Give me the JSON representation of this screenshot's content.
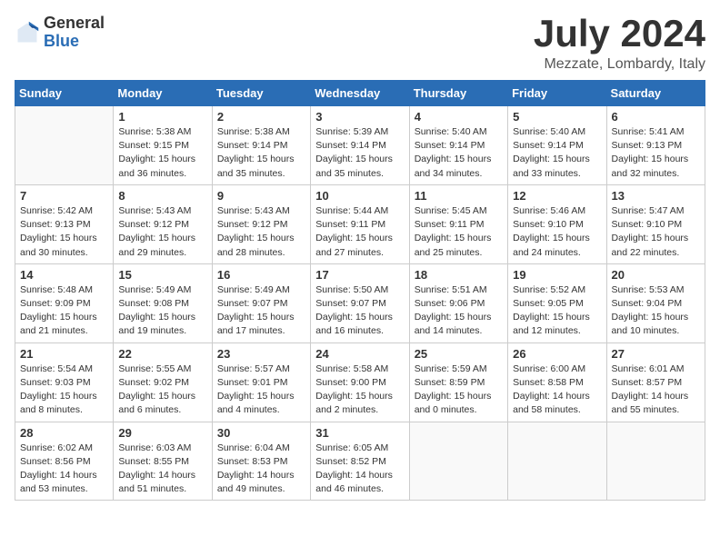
{
  "header": {
    "logo_general": "General",
    "logo_blue": "Blue",
    "month_year": "July 2024",
    "location": "Mezzate, Lombardy, Italy"
  },
  "weekdays": [
    "Sunday",
    "Monday",
    "Tuesday",
    "Wednesday",
    "Thursday",
    "Friday",
    "Saturday"
  ],
  "weeks": [
    [
      {
        "day": "",
        "info": ""
      },
      {
        "day": "1",
        "info": "Sunrise: 5:38 AM\nSunset: 9:15 PM\nDaylight: 15 hours\nand 36 minutes."
      },
      {
        "day": "2",
        "info": "Sunrise: 5:38 AM\nSunset: 9:14 PM\nDaylight: 15 hours\nand 35 minutes."
      },
      {
        "day": "3",
        "info": "Sunrise: 5:39 AM\nSunset: 9:14 PM\nDaylight: 15 hours\nand 35 minutes."
      },
      {
        "day": "4",
        "info": "Sunrise: 5:40 AM\nSunset: 9:14 PM\nDaylight: 15 hours\nand 34 minutes."
      },
      {
        "day": "5",
        "info": "Sunrise: 5:40 AM\nSunset: 9:14 PM\nDaylight: 15 hours\nand 33 minutes."
      },
      {
        "day": "6",
        "info": "Sunrise: 5:41 AM\nSunset: 9:13 PM\nDaylight: 15 hours\nand 32 minutes."
      }
    ],
    [
      {
        "day": "7",
        "info": "Sunrise: 5:42 AM\nSunset: 9:13 PM\nDaylight: 15 hours\nand 30 minutes."
      },
      {
        "day": "8",
        "info": "Sunrise: 5:43 AM\nSunset: 9:12 PM\nDaylight: 15 hours\nand 29 minutes."
      },
      {
        "day": "9",
        "info": "Sunrise: 5:43 AM\nSunset: 9:12 PM\nDaylight: 15 hours\nand 28 minutes."
      },
      {
        "day": "10",
        "info": "Sunrise: 5:44 AM\nSunset: 9:11 PM\nDaylight: 15 hours\nand 27 minutes."
      },
      {
        "day": "11",
        "info": "Sunrise: 5:45 AM\nSunset: 9:11 PM\nDaylight: 15 hours\nand 25 minutes."
      },
      {
        "day": "12",
        "info": "Sunrise: 5:46 AM\nSunset: 9:10 PM\nDaylight: 15 hours\nand 24 minutes."
      },
      {
        "day": "13",
        "info": "Sunrise: 5:47 AM\nSunset: 9:10 PM\nDaylight: 15 hours\nand 22 minutes."
      }
    ],
    [
      {
        "day": "14",
        "info": "Sunrise: 5:48 AM\nSunset: 9:09 PM\nDaylight: 15 hours\nand 21 minutes."
      },
      {
        "day": "15",
        "info": "Sunrise: 5:49 AM\nSunset: 9:08 PM\nDaylight: 15 hours\nand 19 minutes."
      },
      {
        "day": "16",
        "info": "Sunrise: 5:49 AM\nSunset: 9:07 PM\nDaylight: 15 hours\nand 17 minutes."
      },
      {
        "day": "17",
        "info": "Sunrise: 5:50 AM\nSunset: 9:07 PM\nDaylight: 15 hours\nand 16 minutes."
      },
      {
        "day": "18",
        "info": "Sunrise: 5:51 AM\nSunset: 9:06 PM\nDaylight: 15 hours\nand 14 minutes."
      },
      {
        "day": "19",
        "info": "Sunrise: 5:52 AM\nSunset: 9:05 PM\nDaylight: 15 hours\nand 12 minutes."
      },
      {
        "day": "20",
        "info": "Sunrise: 5:53 AM\nSunset: 9:04 PM\nDaylight: 15 hours\nand 10 minutes."
      }
    ],
    [
      {
        "day": "21",
        "info": "Sunrise: 5:54 AM\nSunset: 9:03 PM\nDaylight: 15 hours\nand 8 minutes."
      },
      {
        "day": "22",
        "info": "Sunrise: 5:55 AM\nSunset: 9:02 PM\nDaylight: 15 hours\nand 6 minutes."
      },
      {
        "day": "23",
        "info": "Sunrise: 5:57 AM\nSunset: 9:01 PM\nDaylight: 15 hours\nand 4 minutes."
      },
      {
        "day": "24",
        "info": "Sunrise: 5:58 AM\nSunset: 9:00 PM\nDaylight: 15 hours\nand 2 minutes."
      },
      {
        "day": "25",
        "info": "Sunrise: 5:59 AM\nSunset: 8:59 PM\nDaylight: 15 hours\nand 0 minutes."
      },
      {
        "day": "26",
        "info": "Sunrise: 6:00 AM\nSunset: 8:58 PM\nDaylight: 14 hours\nand 58 minutes."
      },
      {
        "day": "27",
        "info": "Sunrise: 6:01 AM\nSunset: 8:57 PM\nDaylight: 14 hours\nand 55 minutes."
      }
    ],
    [
      {
        "day": "28",
        "info": "Sunrise: 6:02 AM\nSunset: 8:56 PM\nDaylight: 14 hours\nand 53 minutes."
      },
      {
        "day": "29",
        "info": "Sunrise: 6:03 AM\nSunset: 8:55 PM\nDaylight: 14 hours\nand 51 minutes."
      },
      {
        "day": "30",
        "info": "Sunrise: 6:04 AM\nSunset: 8:53 PM\nDaylight: 14 hours\nand 49 minutes."
      },
      {
        "day": "31",
        "info": "Sunrise: 6:05 AM\nSunset: 8:52 PM\nDaylight: 14 hours\nand 46 minutes."
      },
      {
        "day": "",
        "info": ""
      },
      {
        "day": "",
        "info": ""
      },
      {
        "day": "",
        "info": ""
      }
    ]
  ]
}
